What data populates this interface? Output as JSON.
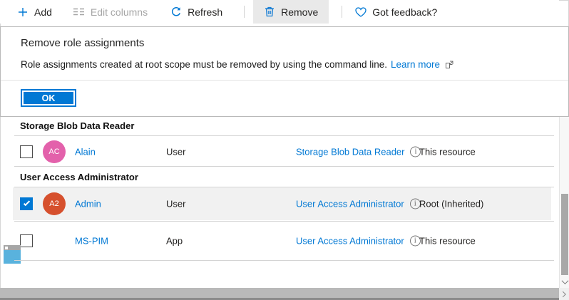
{
  "toolbar": {
    "add": "Add",
    "edit_columns": "Edit columns",
    "refresh": "Refresh",
    "remove": "Remove",
    "feedback": "Got feedback?"
  },
  "dialog": {
    "title": "Remove role assignments",
    "message": "Role assignments created at root scope must be removed by using the command line.",
    "learn_more": "Learn more",
    "ok": "OK"
  },
  "table": {
    "groups": [
      {
        "header": "Storage Blob Data Reader",
        "rows": [
          {
            "checked": false,
            "avatar": "AC",
            "avatar_color": "#e361ab",
            "name": "Alain",
            "type": "User",
            "role": "Storage Blob Data Reader",
            "scope": "This resource"
          }
        ]
      },
      {
        "header": "User Access Administrator",
        "rows": [
          {
            "checked": true,
            "avatar": "A2",
            "avatar_color": "#d6502d",
            "name": "Admin",
            "type": "User",
            "role": "User Access Administrator",
            "scope": "Root (Inherited)"
          },
          {
            "checked": false,
            "avatar": "",
            "avatar_color": "",
            "name": "MS-PIM",
            "type": "App",
            "role": "User Access Administrator",
            "scope": "This resource"
          }
        ]
      }
    ]
  },
  "icons": {
    "info": "i"
  },
  "colors": {
    "accent": "#0078d4",
    "link": "#0078d4",
    "row_highlight": "#f1f1f1",
    "checkbox_checked": "#0078d4",
    "avatar_alain": "#e361ab",
    "avatar_admin": "#d6502d",
    "disabled_text": "#a6a6a6"
  }
}
